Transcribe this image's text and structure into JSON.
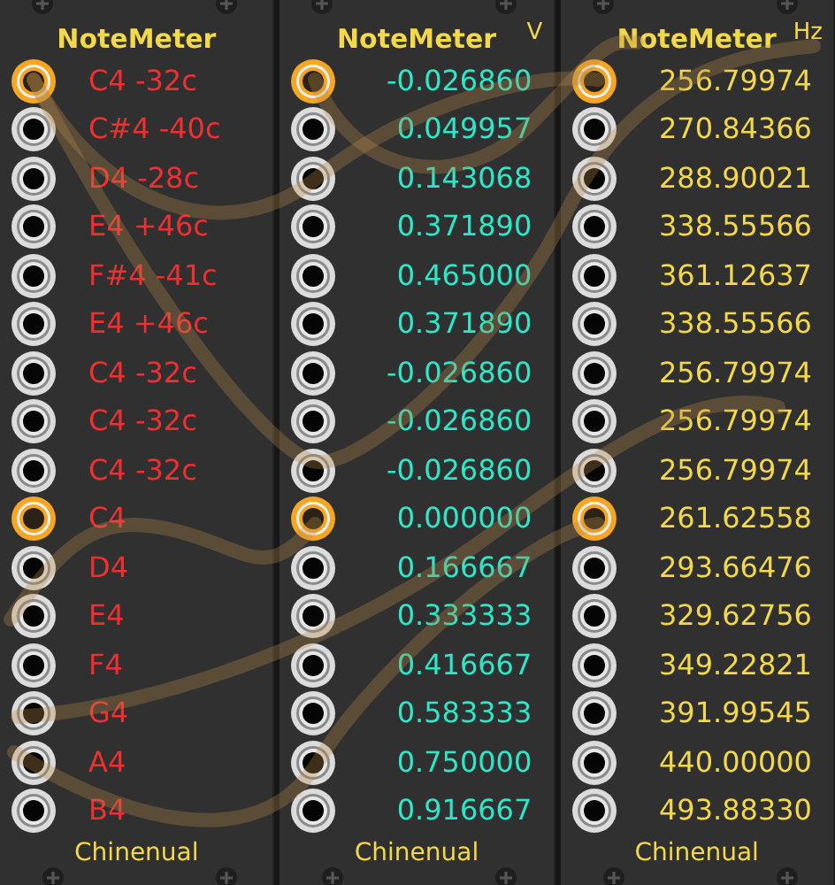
{
  "modules": [
    {
      "kind": "note",
      "title": "NoteMeter",
      "rows": [
        {
          "text": "C4 -32c",
          "connected": true
        },
        {
          "text": "C#4 -40c",
          "connected": false
        },
        {
          "text": "D4 -28c",
          "connected": false
        },
        {
          "text": "E4 +46c",
          "connected": false
        },
        {
          "text": "F#4 -41c",
          "connected": false
        },
        {
          "text": "E4 +46c",
          "connected": false
        },
        {
          "text": "C4 -32c",
          "connected": false
        },
        {
          "text": "C4 -32c",
          "connected": false
        },
        {
          "text": "C4 -32c",
          "connected": false
        },
        {
          "text": "C4",
          "connected": true
        },
        {
          "text": "D4",
          "connected": false
        },
        {
          "text": "E4",
          "connected": false
        },
        {
          "text": "F4",
          "connected": false
        },
        {
          "text": "G4",
          "connected": false
        },
        {
          "text": "A4",
          "connected": false
        },
        {
          "text": "B4",
          "connected": false
        }
      ],
      "footer": "Chinenual"
    },
    {
      "kind": "voltage",
      "title": "NoteMeter",
      "unit": "V",
      "rows": [
        {
          "text": "-0.026860",
          "connected": true
        },
        {
          "text": "0.049957",
          "connected": false
        },
        {
          "text": "0.143068",
          "connected": false
        },
        {
          "text": "0.371890",
          "connected": false
        },
        {
          "text": "0.465000",
          "connected": false
        },
        {
          "text": "0.371890",
          "connected": false
        },
        {
          "text": "-0.026860",
          "connected": false
        },
        {
          "text": "-0.026860",
          "connected": false
        },
        {
          "text": "-0.026860",
          "connected": false
        },
        {
          "text": "0.000000",
          "connected": true
        },
        {
          "text": "0.166667",
          "connected": false
        },
        {
          "text": "0.333333",
          "connected": false
        },
        {
          "text": "0.416667",
          "connected": false
        },
        {
          "text": "0.583333",
          "connected": false
        },
        {
          "text": "0.750000",
          "connected": false
        },
        {
          "text": "0.916667",
          "connected": false
        }
      ],
      "footer": "Chinenual"
    },
    {
      "kind": "frequency",
      "title": "NoteMeter",
      "unit": "Hz",
      "rows": [
        {
          "text": "256.79974",
          "connected": true
        },
        {
          "text": "270.84366",
          "connected": false
        },
        {
          "text": "288.90021",
          "connected": false
        },
        {
          "text": "338.55566",
          "connected": false
        },
        {
          "text": "361.12637",
          "connected": false
        },
        {
          "text": "338.55566",
          "connected": false
        },
        {
          "text": "256.79974",
          "connected": false
        },
        {
          "text": "256.79974",
          "connected": false
        },
        {
          "text": "256.79974",
          "connected": false
        },
        {
          "text": "261.62558",
          "connected": true
        },
        {
          "text": "293.66476",
          "connected": false
        },
        {
          "text": "329.62756",
          "connected": false
        },
        {
          "text": "349.22821",
          "connected": false
        },
        {
          "text": "391.99545",
          "connected": false
        },
        {
          "text": "440.00000",
          "connected": false
        },
        {
          "text": "493.88330",
          "connected": false
        }
      ],
      "footer": "Chinenual"
    }
  ]
}
